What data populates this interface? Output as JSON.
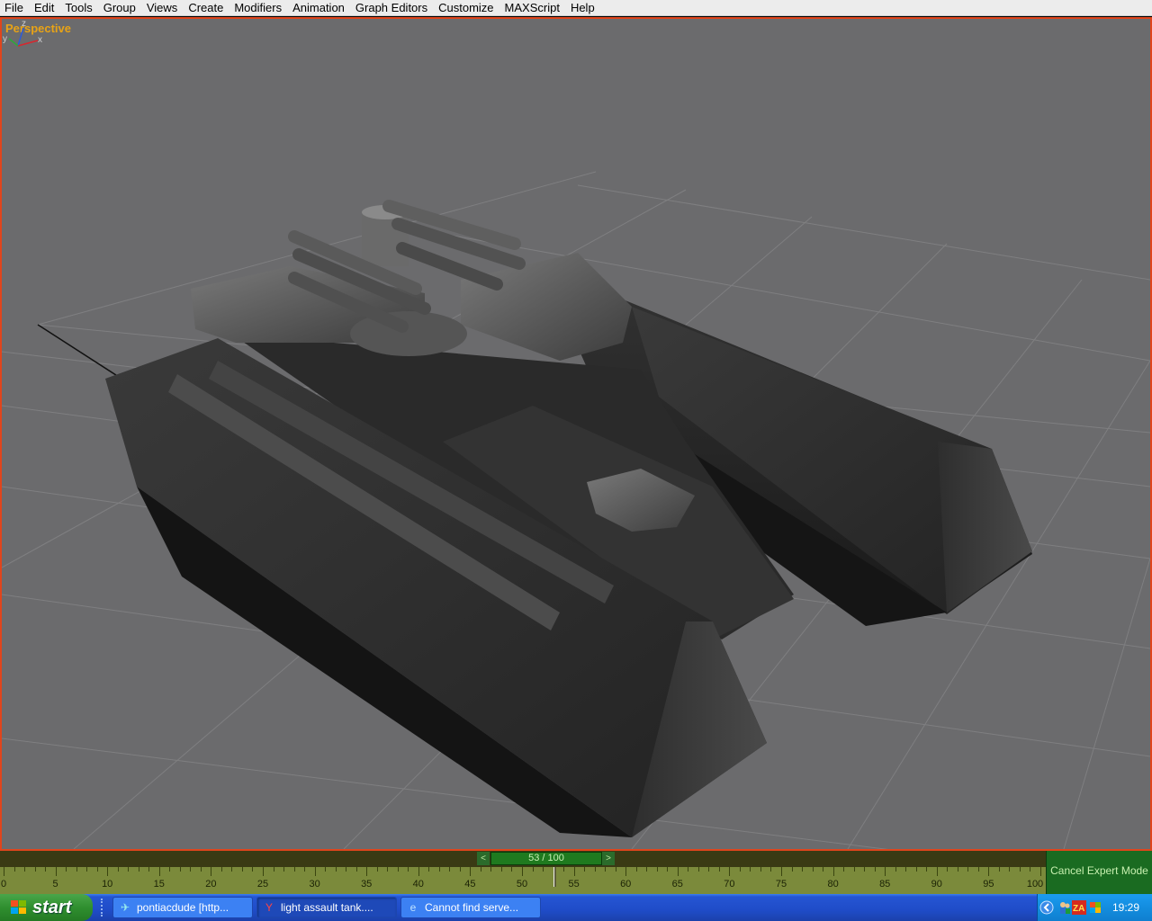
{
  "menu": [
    "File",
    "Edit",
    "Tools",
    "Group",
    "Views",
    "Create",
    "Modifiers",
    "Animation",
    "Graph Editors",
    "Customize",
    "MAXScript",
    "Help"
  ],
  "viewport": {
    "label": "Perspective",
    "axes": {
      "y": "y",
      "z": "z",
      "x": "x"
    }
  },
  "timeline": {
    "frame_display": "53 / 100",
    "prev_icon": "<",
    "next_icon": ">",
    "current_frame": 53,
    "total_frames": 100,
    "ruler_labels": [
      "0",
      "5",
      "10",
      "15",
      "20",
      "25",
      "30",
      "35",
      "40",
      "45",
      "50",
      "55",
      "60",
      "65",
      "70",
      "75",
      "80",
      "85",
      "90",
      "95",
      "100"
    ]
  },
  "expert_mode_button": "Cancel Expert Mode",
  "taskbar": {
    "start_label": "start",
    "tasks": [
      {
        "label": "pontiacdude [http...",
        "icon": "app-icon"
      },
      {
        "label": "light assault tank....",
        "icon": "paint-icon"
      },
      {
        "label": "Cannot find serve...",
        "icon": "ie-icon"
      }
    ],
    "clock": "19:29",
    "tray_icons": [
      "chevron-left-icon",
      "network-users-icon",
      "zonealarm-icon",
      "flag-icon"
    ]
  },
  "colors": {
    "viewport_border": "#e0451c",
    "viewport_label": "#e8a316",
    "viewport_bg": "#6b6b6d",
    "timeline_bar": "#1f7a1f"
  }
}
